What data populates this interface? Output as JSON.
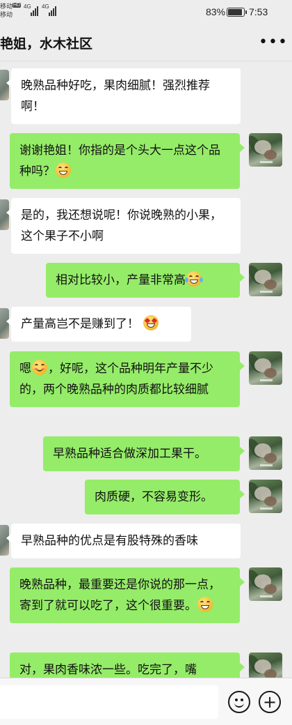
{
  "status_bar": {
    "carrier_1": "移动",
    "carrier_2": "移动",
    "network_1": "4G",
    "network_2": "4G",
    "hd_badge": "HD",
    "battery_percent": "83%",
    "battery_level": 0.83,
    "time": "7:53"
  },
  "header": {
    "title": "艳姐，水木社区",
    "more_icon": "more-dots-icon",
    "more_label": "•••"
  },
  "messages": [
    {
      "side": "in",
      "segments": [
        {
          "text": "晚熟品种好吃，果肉细腻！强烈推荐啊！"
        }
      ]
    },
    {
      "side": "out",
      "segments": [
        {
          "text": "谢谢艳姐！你指的是个头大一点这个品种吗？"
        },
        {
          "emoji": "grin"
        }
      ]
    },
    {
      "side": "in",
      "segments": [
        {
          "text": "是的，我还想说呢！你说晚熟的小果，这个果子不小啊"
        }
      ]
    },
    {
      "side": "out",
      "segments": [
        {
          "text": "相对比较小，产量非常高"
        },
        {
          "emoji": "tears-of-joy"
        }
      ]
    },
    {
      "side": "in",
      "segments": [
        {
          "text": "产量高岂不是赚到了！"
        },
        {
          "emoji": "heart-eyes"
        }
      ]
    },
    {
      "side": "out",
      "segments": [
        {
          "text": "嗯"
        },
        {
          "emoji": "smile"
        },
        {
          "text": "，好呢，这个品种明年产量不少的，两个晚熟品种的肉质都比较细腻"
        }
      ]
    },
    {
      "side": "out",
      "segments": [
        {
          "text": "早熟品种适合做深加工果干。"
        }
      ]
    },
    {
      "side": "out",
      "segments": [
        {
          "text": "肉质硬，不容易变形。"
        }
      ]
    },
    {
      "side": "in",
      "segments": [
        {
          "text": "早熟品种的优点是有股特殊的香味"
        }
      ]
    },
    {
      "side": "out",
      "segments": [
        {
          "text": "晚熟品种，最重要还是你说的那一点，寄到了就可以吃了，这个很重要。"
        },
        {
          "emoji": "grin"
        }
      ]
    },
    {
      "side": "out",
      "segments": [
        {
          "text": "对，果肉香味浓一些。吃完了，嘴"
        }
      ]
    }
  ],
  "input_bar": {
    "emoji_icon": "emoji-face-icon",
    "plus_icon": "plus-icon",
    "plus_label": "+"
  },
  "colors": {
    "background": "#ededed",
    "incoming_bubble": "#ffffff",
    "outgoing_bubble": "#95ec69"
  }
}
